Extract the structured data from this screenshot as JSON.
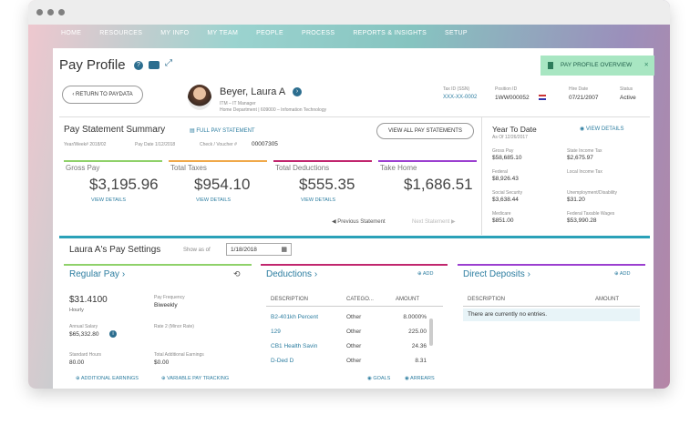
{
  "nav": [
    "HOME",
    "RESOURCES",
    "MY INFO",
    "MY TEAM",
    "PEOPLE",
    "PROCESS",
    "REPORTS & INSIGHTS",
    "SETUP"
  ],
  "page_title": "Pay Profile",
  "overview_button": "PAY PROFILE OVERVIEW",
  "back_button": "RETURN TO PAYDATA",
  "employee": {
    "name": "Beyer, Laura A",
    "title": "ITM – IT Manager",
    "dept": "Home Department | 609000 – Infomation Technology",
    "tax_id_label": "Tax ID (SSN)",
    "tax_id": "XXX-XX-0002",
    "position_label": "Position ID",
    "position": "1WW000052",
    "hire_label": "Hire Date",
    "hire": "07/21/2007",
    "status_label": "Status",
    "status": "Active"
  },
  "summary": {
    "title": "Pay Statement Summary",
    "full_link": "FULL PAY STATEMENT",
    "view_all": "VIEW ALL PAY STATEMENTS",
    "year_week": "Year/Week# 2018/02",
    "pay_date": "Pay Date 1/12/2018",
    "check": "Check / Voucher #",
    "check_val": "00007305",
    "cards": [
      {
        "label": "Gross Pay",
        "value": "$3,195.96",
        "link": "VIEW DETAILS",
        "color": "#8fd16a"
      },
      {
        "label": "Total Taxes",
        "value": "$954.10",
        "link": "VIEW DETAILS",
        "color": "#f0a94a"
      },
      {
        "label": "Total Deductions",
        "value": "$555.35",
        "link": "VIEW DETAILS",
        "color": "#c1266e"
      },
      {
        "label": "Take Home",
        "value": "$1,686.51",
        "link": "",
        "color": "#9b3fd0"
      }
    ],
    "prev": "Previous Statement",
    "next": "Next Statement"
  },
  "ytd": {
    "title": "Year To Date",
    "as_of": "As Of 12/26/2017",
    "view": "VIEW DETAILS",
    "items": [
      {
        "label": "Gross Pay",
        "value": "$58,685.10"
      },
      {
        "label": "State Income Tax",
        "value": "$2,675.97"
      },
      {
        "label": "Federal",
        "value": "$8,926.43"
      },
      {
        "label": "Local Income Tax",
        "value": ""
      },
      {
        "label": "Social Security",
        "value": "$3,638.44"
      },
      {
        "label": "Unemployment/Disability",
        "value": "$31.20"
      },
      {
        "label": "Medicare",
        "value": "$851.00"
      },
      {
        "label": "Federal Taxable Wages",
        "value": "$53,990.28"
      }
    ]
  },
  "settings": {
    "title": "Laura A's Pay Settings",
    "show_as_of": "Show as of",
    "date": "1/18/2018"
  },
  "regular": {
    "title": "Regular Pay",
    "rate": "$31.4100",
    "rate_unit": "Hourly",
    "freq_label": "Pay Frequency",
    "freq": "Biweekly",
    "annual_label": "Annual Salary",
    "annual": "$65,332.80",
    "rate2_label": "Rate 2 (Minor Rate)",
    "std_label": "Standard Hours",
    "std": "80.00",
    "addl_label": "Total Additional Earnings",
    "addl": "$0.00",
    "link1": "ADDITIONAL EARNINGS",
    "link2": "VARIABLE PAY TRACKING"
  },
  "deductions": {
    "title": "Deductions",
    "add": "ADD",
    "headers": [
      "DESCRIPTION",
      "CATEGO...",
      "AMOUNT"
    ],
    "rows": [
      [
        "B2-401kh Percent",
        "Other",
        "8.0000%"
      ],
      [
        "129",
        "Other",
        "225.00"
      ],
      [
        "CB1 Health Savin",
        "Other",
        "24.36"
      ],
      [
        "D-Ded D",
        "Other",
        "8.31"
      ]
    ],
    "goals": "GOALS",
    "arrears": "ARREARS"
  },
  "deposits": {
    "title": "Direct Deposits",
    "add": "ADD",
    "headers": [
      "DESCRIPTION",
      "AMOUNT"
    ],
    "empty": "There are currently no entries."
  }
}
